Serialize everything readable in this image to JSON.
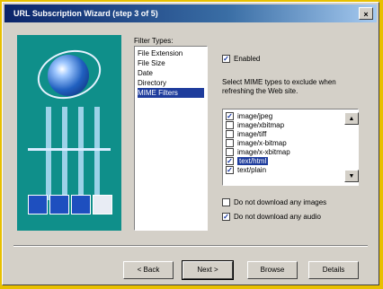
{
  "window": {
    "title": "URL Subscription Wizard (step 3 of 5)",
    "close_label": "×"
  },
  "file_types": {
    "label": "Filter Types:",
    "items": [
      "File Extension",
      "File Size",
      "Date",
      "Directory",
      "MIME Filters"
    ],
    "selected_index": 4
  },
  "enabled": {
    "label": "Enabled",
    "checked": true
  },
  "description": "Select MIME types to exclude when refreshing the Web site.",
  "mime_types": [
    {
      "label": "image/jpeg",
      "checked": true,
      "selected": false
    },
    {
      "label": "image/xbitmap",
      "checked": false,
      "selected": false
    },
    {
      "label": "image/tiff",
      "checked": false,
      "selected": false
    },
    {
      "label": "image/x-bitmap",
      "checked": false,
      "selected": false
    },
    {
      "label": "image/x-xbitmap",
      "checked": false,
      "selected": false
    },
    {
      "label": "text/html",
      "checked": true,
      "selected": true
    },
    {
      "label": "text/plain",
      "checked": true,
      "selected": false
    }
  ],
  "options": [
    {
      "label": "Do not download any images",
      "checked": false
    },
    {
      "label": "Do not download any audio",
      "checked": true
    }
  ],
  "buttons": {
    "back": "< Back",
    "next": "Next >",
    "browse": "Browse",
    "details": "Details"
  },
  "colors": {
    "title_start": "#0a246a",
    "title_end": "#a6caf0",
    "art_bg": "#0f8f8a",
    "selection": "#1e3c9c",
    "outer": "#e8c000"
  }
}
